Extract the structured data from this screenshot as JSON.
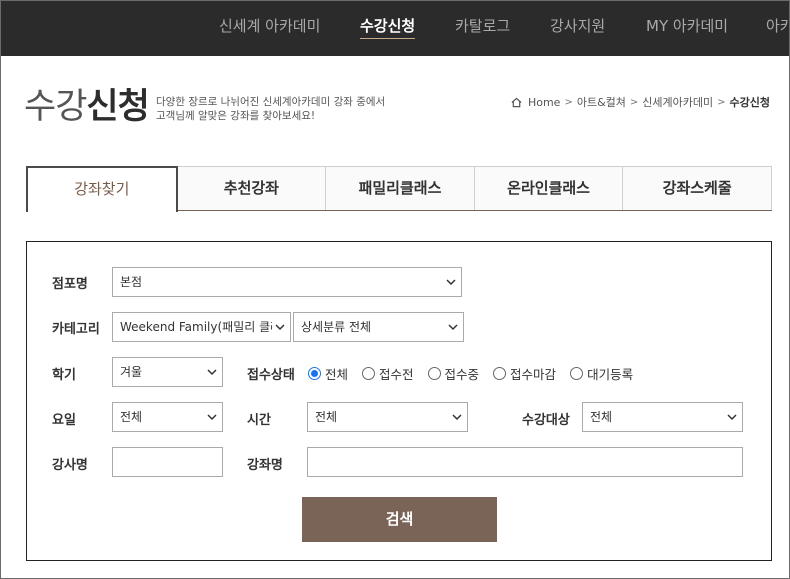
{
  "topnav": {
    "items": [
      {
        "label": "신세계 아카데미"
      },
      {
        "label": "수강신청",
        "active": true
      },
      {
        "label": "카탈로그"
      },
      {
        "label": "강사지원"
      },
      {
        "label": "MY 아카데미"
      },
      {
        "label": "아카"
      }
    ]
  },
  "header": {
    "title_thin": "수강",
    "title_bold": "신청",
    "desc_line1": "다양한 장르로 나뉘어진 신세계아카데미 강좌 중에서",
    "desc_line2": "고객님께 알맞은 강좌를 찾아보세요!"
  },
  "breadcrumb": {
    "items": [
      "Home",
      "아트&컬쳐",
      "신세계아카데미",
      "수강신청"
    ]
  },
  "tabs": [
    "강좌찾기",
    "추천강좌",
    "패밀리클래스",
    "온라인클래스",
    "강좌스케줄"
  ],
  "form": {
    "store_label": "점포명",
    "store_value": "본점",
    "category_label": "카테고리",
    "category_value": "Weekend Family(패밀리 클래",
    "subcategory_value": "상세분류 전체",
    "term_label": "학기",
    "term_value": "겨울",
    "status_label": "접수상태",
    "status_options": [
      "전체",
      "접수전",
      "접수중",
      "접수마감",
      "대기등록"
    ],
    "status_selected": "전체",
    "day_label": "요일",
    "day_value": "전체",
    "time_label": "시간",
    "time_value": "전체",
    "target_label": "수강대상",
    "target_value": "전체",
    "instructor_label": "강사명",
    "instructor_value": "",
    "course_label": "강좌명",
    "course_value": "",
    "search_button": "검색"
  },
  "colors": {
    "nav_bg": "#2b2b2b",
    "accent_brown": "#7a6458",
    "radio_blue": "#1a73e8"
  }
}
